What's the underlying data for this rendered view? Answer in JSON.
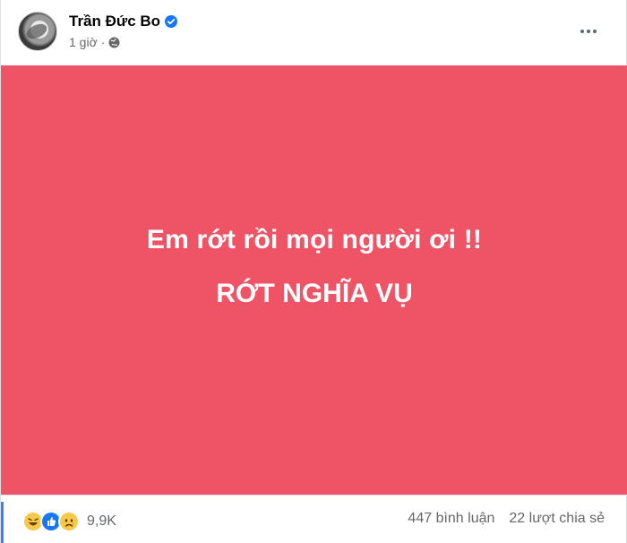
{
  "post": {
    "author": "Trần Đức Bo",
    "time": "1 giờ",
    "separator": "·",
    "image_text": {
      "line1": "Em rớt rồi mọi người ơi !!",
      "line2": "RỚT NGHĨA VỤ"
    },
    "image_background": "#ef5466",
    "reactions": {
      "icons": [
        "haha-icon",
        "like-icon",
        "sad-icon"
      ],
      "count": "9,9K"
    },
    "comments": "447 bình luận",
    "shares": "22 lượt chia sẻ"
  },
  "colors": {
    "verified": "#1877f2",
    "secondary_text": "#65676b"
  }
}
